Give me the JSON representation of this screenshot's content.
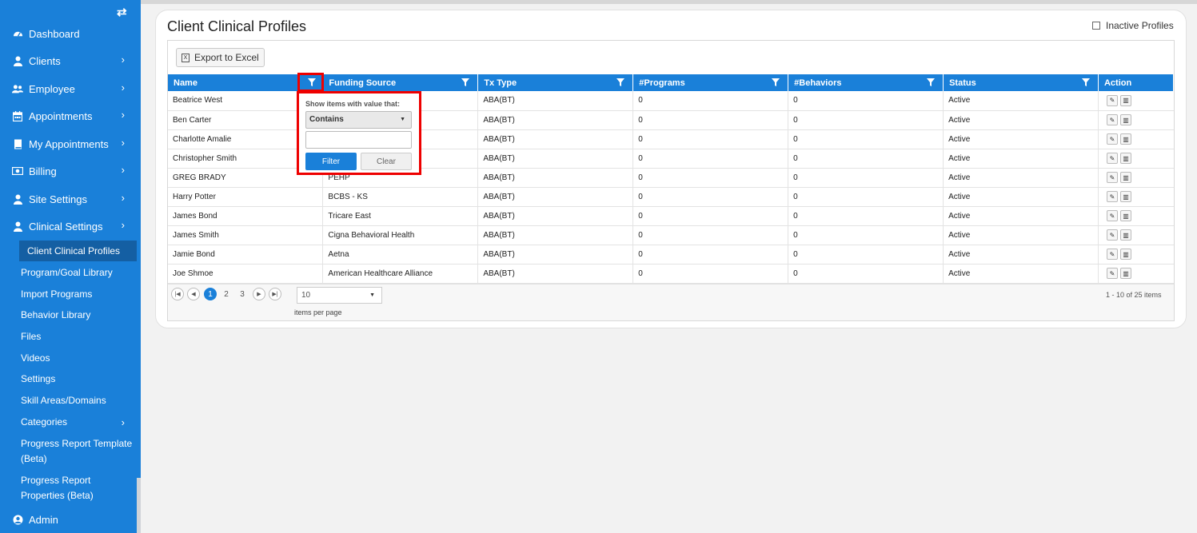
{
  "sidebar": {
    "nav": [
      {
        "label": "Dashboard",
        "icon": "dashboard-icon",
        "chevron": false
      },
      {
        "label": "Clients",
        "icon": "user-icon",
        "chevron": true
      },
      {
        "label": "Employee",
        "icon": "users-icon",
        "chevron": true
      },
      {
        "label": "Appointments",
        "icon": "calendar-icon",
        "chevron": true
      },
      {
        "label": "My Appointments",
        "icon": "book-icon",
        "chevron": true
      },
      {
        "label": "Billing",
        "icon": "money-icon",
        "chevron": true
      },
      {
        "label": "Site Settings",
        "icon": "user-icon",
        "chevron": true
      },
      {
        "label": "Clinical Settings",
        "icon": "user-icon",
        "chevron": true
      }
    ],
    "sub": [
      {
        "label": "Client Clinical Profiles",
        "active": true
      },
      {
        "label": "Program/Goal Library"
      },
      {
        "label": "Import Programs"
      },
      {
        "label": "Behavior Library"
      },
      {
        "label": "Files"
      },
      {
        "label": "Videos"
      },
      {
        "label": "Settings"
      },
      {
        "label": "Skill Areas/Domains"
      },
      {
        "label": "Categories"
      },
      {
        "label": "Progress Report Template (Beta)"
      },
      {
        "label": "Progress Report Properties (Beta)"
      }
    ],
    "admin": "Admin"
  },
  "page": {
    "title": "Client Clinical Profiles",
    "inactive_label": "Inactive Profiles",
    "export_label": "Export to Excel"
  },
  "grid": {
    "columns": [
      "Name",
      "Funding Source",
      "Tx Type",
      "#Programs",
      "#Behaviors",
      "Status",
      "Action"
    ],
    "rows": [
      [
        "Beatrice West",
        "",
        "ABA(BT)",
        "0",
        "0",
        "Active"
      ],
      [
        "Ben Carter",
        "",
        "ABA(BT)",
        "0",
        "0",
        "Active"
      ],
      [
        "Charlotte Amalie",
        "",
        "ABA(BT)",
        "0",
        "0",
        "Active"
      ],
      [
        "Christopher Smith",
        "",
        "ABA(BT)",
        "0",
        "0",
        "Active"
      ],
      [
        "GREG BRADY",
        "PEHP",
        "ABA(BT)",
        "0",
        "0",
        "Active"
      ],
      [
        "Harry Potter",
        "BCBS - KS",
        "ABA(BT)",
        "0",
        "0",
        "Active"
      ],
      [
        "James Bond",
        "Tricare East",
        "ABA(BT)",
        "0",
        "0",
        "Active"
      ],
      [
        "James Smith",
        "Cigna Behavioral Health",
        "ABA(BT)",
        "0",
        "0",
        "Active"
      ],
      [
        "Jamie Bond",
        "Aetna",
        "ABA(BT)",
        "0",
        "0",
        "Active"
      ],
      [
        "Joe Shmoe",
        "American Healthcare Alliance",
        "ABA(BT)",
        "0",
        "0",
        "Active"
      ]
    ]
  },
  "pager": {
    "pages": [
      "1",
      "2",
      "3"
    ],
    "page_size": "10",
    "items_per_page": "items per page",
    "info": "1 - 10 of 25 items"
  },
  "filter_popup": {
    "label": "Show items with value that:",
    "operator": "Contains",
    "value": "",
    "filter_btn": "Filter",
    "clear_btn": "Clear"
  },
  "colors": {
    "accent": "#1a80d9",
    "highlight": "#ee0000"
  }
}
